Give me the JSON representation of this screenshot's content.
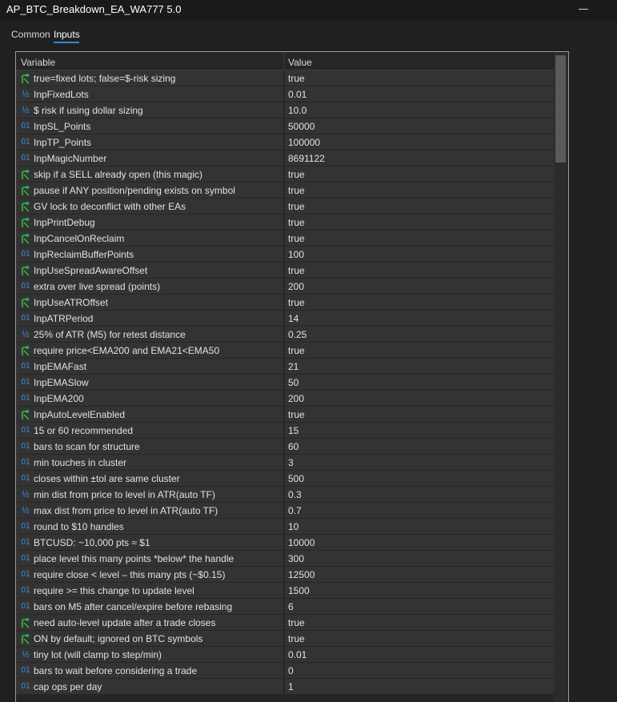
{
  "window": {
    "title": "AP_BTC_Breakdown_EA_WA777 5.0"
  },
  "tabs": [
    {
      "label": "Common"
    },
    {
      "label": "Inputs"
    }
  ],
  "table": {
    "headers": {
      "variable": "Variable",
      "value": "Value"
    },
    "rows": [
      {
        "icon": "bool",
        "name": "true=fixed lots; false=$-risk sizing",
        "value": "true"
      },
      {
        "icon": "double",
        "name": "InpFixedLots",
        "value": "0.01"
      },
      {
        "icon": "double",
        "name": "$ risk if using dollar sizing",
        "value": "10.0"
      },
      {
        "icon": "int",
        "name": "InpSL_Points",
        "value": "50000"
      },
      {
        "icon": "int",
        "name": "InpTP_Points",
        "value": "100000"
      },
      {
        "icon": "int",
        "name": "InpMagicNumber",
        "value": "8691122"
      },
      {
        "icon": "bool",
        "name": "skip if a SELL already open (this magic)",
        "value": "true"
      },
      {
        "icon": "bool",
        "name": "pause if ANY position/pending exists on symbol",
        "value": "true"
      },
      {
        "icon": "bool",
        "name": "GV lock to deconflict with other EAs",
        "value": "true"
      },
      {
        "icon": "bool",
        "name": "InpPrintDebug",
        "value": "true"
      },
      {
        "icon": "bool",
        "name": "InpCancelOnReclaim",
        "value": "true"
      },
      {
        "icon": "int",
        "name": "InpReclaimBufferPoints",
        "value": "100"
      },
      {
        "icon": "bool",
        "name": "InpUseSpreadAwareOffset",
        "value": "true"
      },
      {
        "icon": "int",
        "name": "extra over live spread (points)",
        "value": "200"
      },
      {
        "icon": "bool",
        "name": "InpUseATROffset",
        "value": "true"
      },
      {
        "icon": "int",
        "name": "InpATRPeriod",
        "value": "14"
      },
      {
        "icon": "double",
        "name": "25% of ATR (M5) for retest distance",
        "value": "0.25"
      },
      {
        "icon": "bool",
        "name": "require price<EMA200 and EMA21<EMA50",
        "value": "true"
      },
      {
        "icon": "int",
        "name": "InpEMAFast",
        "value": "21"
      },
      {
        "icon": "int",
        "name": "InpEMASlow",
        "value": "50"
      },
      {
        "icon": "int",
        "name": "InpEMA200",
        "value": "200"
      },
      {
        "icon": "bool",
        "name": "InpAutoLevelEnabled",
        "value": "true"
      },
      {
        "icon": "int",
        "name": "15 or 60 recommended",
        "value": "15"
      },
      {
        "icon": "int",
        "name": "bars to scan for structure",
        "value": "60"
      },
      {
        "icon": "int",
        "name": "min touches in cluster",
        "value": "3"
      },
      {
        "icon": "int",
        "name": "closes within ±tol are same cluster",
        "value": "500"
      },
      {
        "icon": "double",
        "name": "min dist from price to level in ATR(auto TF)",
        "value": "0.3"
      },
      {
        "icon": "double",
        "name": "max dist from price to level in ATR(auto TF)",
        "value": "0.7"
      },
      {
        "icon": "int",
        "name": "round to $10 handles",
        "value": "10"
      },
      {
        "icon": "int",
        "name": "BTCUSD: ~10,000 pts ≈ $1",
        "value": "10000"
      },
      {
        "icon": "int",
        "name": "place level this many points *below* the handle",
        "value": "300"
      },
      {
        "icon": "int",
        "name": "require close < level – this many pts (~$0.15)",
        "value": "12500"
      },
      {
        "icon": "int",
        "name": "require >= this change to update level",
        "value": "1500"
      },
      {
        "icon": "int",
        "name": "bars on M5 after cancel/expire before rebasing",
        "value": "6"
      },
      {
        "icon": "bool",
        "name": "need auto-level update after a trade closes",
        "value": "true"
      },
      {
        "icon": "bool",
        "name": "ON by default; ignored on BTC symbols",
        "value": "true"
      },
      {
        "icon": "double",
        "name": "tiny lot (will clamp to step/min)",
        "value": "0.01"
      },
      {
        "icon": "int",
        "name": "bars to wait before considering a trade",
        "value": "0"
      },
      {
        "icon": "int",
        "name": "cap ops per day",
        "value": "1"
      }
    ]
  },
  "icons": {
    "bool": "bool-arrow-icon",
    "int": "integer-01-icon",
    "double": "fraction-half-icon"
  },
  "colors": {
    "accent": "#2d8ad8",
    "icon_blue": "#3d8fe0",
    "icon_green": "#2fbf4a"
  }
}
